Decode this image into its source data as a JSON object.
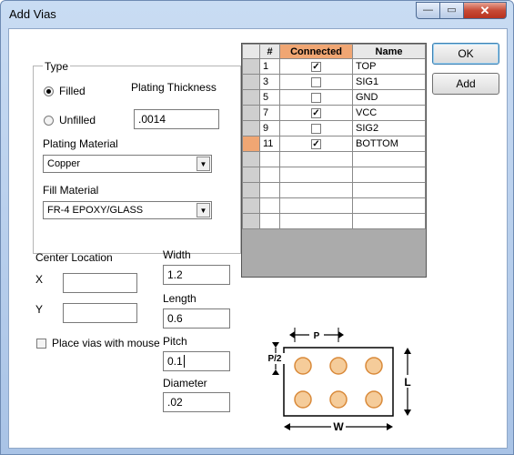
{
  "window": {
    "title": "Add Vias",
    "min_glyph": "—",
    "max_glyph": "▭",
    "close_glyph": "✕"
  },
  "type_group": {
    "label": "Type",
    "radio_filled": "Filled",
    "radio_unfilled": "Unfilled",
    "selected": "Filled",
    "plating_thickness_label": "Plating Thickness",
    "plating_thickness_value": ".0014",
    "plating_material_label": "Plating Material",
    "plating_material_value": "Copper",
    "fill_material_label": "Fill Material",
    "fill_material_value": "FR-4 EPOXY/GLASS"
  },
  "center_location": {
    "label": "Center Location",
    "x_label": "X",
    "y_label": "Y",
    "x_value": "",
    "y_value": ""
  },
  "place_with_mouse": {
    "label": "Place vias with mouse",
    "checked": false
  },
  "dimensions": {
    "width_label": "Width",
    "width_value": "1.2",
    "length_label": "Length",
    "length_value": "0.6",
    "pitch_label": "Pitch",
    "pitch_value": "0.1",
    "diameter_label": "Diameter",
    "diameter_value": ".02"
  },
  "layer_grid": {
    "headers": [
      "#",
      "Connected",
      "Name"
    ],
    "rows": [
      {
        "num": "1",
        "connected": true,
        "name": "TOP"
      },
      {
        "num": "3",
        "connected": false,
        "name": "SIG1"
      },
      {
        "num": "5",
        "connected": false,
        "name": "GND"
      },
      {
        "num": "7",
        "connected": true,
        "name": "VCC"
      },
      {
        "num": "9",
        "connected": false,
        "name": "SIG2"
      },
      {
        "num": "11",
        "connected": true,
        "name": "BOTTOM"
      }
    ],
    "empty_rows": 5,
    "active_row": 5
  },
  "buttons": {
    "ok": "OK",
    "add": "Add"
  },
  "diagram": {
    "p_label": "P",
    "half_p_label": "P/2",
    "l_label": "L",
    "w_label": "W"
  },
  "colors": {
    "accent": "#f0a673",
    "via_fill": "#f5cc9a"
  }
}
